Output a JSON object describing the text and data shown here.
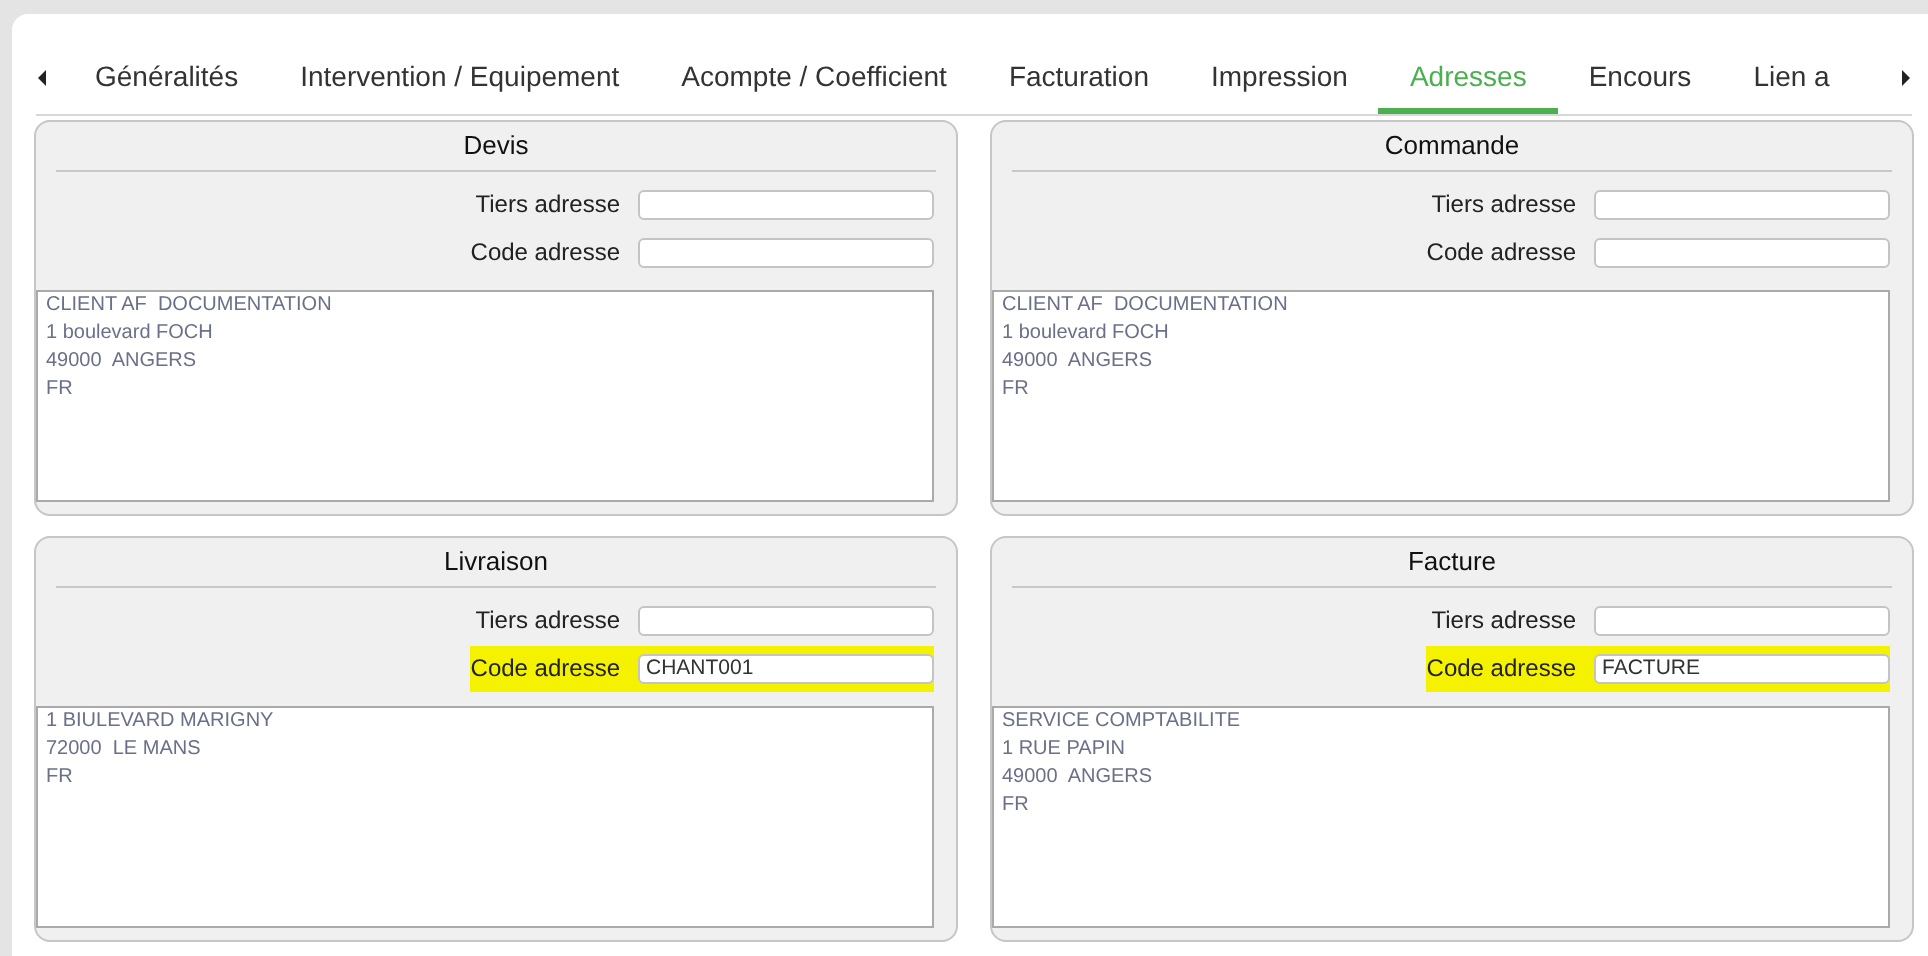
{
  "tabs": [
    {
      "label": "Généralités",
      "selected": false
    },
    {
      "label": "Intervention / Equipement",
      "selected": false
    },
    {
      "label": "Acompte / Coefficient",
      "selected": false
    },
    {
      "label": "Facturation",
      "selected": false
    },
    {
      "label": "Impression",
      "selected": false
    },
    {
      "label": "Adresses",
      "selected": true
    },
    {
      "label": "Encours",
      "selected": false
    },
    {
      "label": "Lien a",
      "selected": false
    }
  ],
  "panels": [
    {
      "title": "Devis",
      "fields": [
        {
          "label": "Tiers adresse",
          "highlighted": false
        },
        {
          "label": "Code adresse",
          "highlighted": false
        }
      ],
      "address_lines": [
        "CLIENT AF  DOCUMENTATION",
        "1 boulevard FOCH",
        "49000  ANGERS",
        "FR"
      ]
    },
    {
      "title": "Commande",
      "fields": [
        {
          "label": "Tiers adresse",
          "highlighted": false
        },
        {
          "label": "Code adresse",
          "highlighted": false
        }
      ],
      "address_lines": [
        "CLIENT AF  DOCUMENTATION",
        "1 boulevard FOCH",
        "49000  ANGERS",
        "FR"
      ]
    },
    {
      "title": "Livraison",
      "fields": [
        {
          "label": "Tiers adresse",
          "highlighted": false
        },
        {
          "label": "Code adresse",
          "value": "CHANT001",
          "highlighted": true
        }
      ],
      "address_lines": [
        "1 BIULEVARD MARIGNY",
        "72000  LE MANS",
        "FR"
      ]
    },
    {
      "title": "Facture",
      "fields": [
        {
          "label": "Tiers adresse",
          "highlighted": false
        },
        {
          "label": "Code adresse",
          "value": "FACTURE",
          "highlighted": true
        }
      ],
      "address_lines": [
        "SERVICE COMPTABILITE",
        "1 RUE PAPIN",
        "49000  ANGERS",
        "FR"
      ]
    }
  ]
}
